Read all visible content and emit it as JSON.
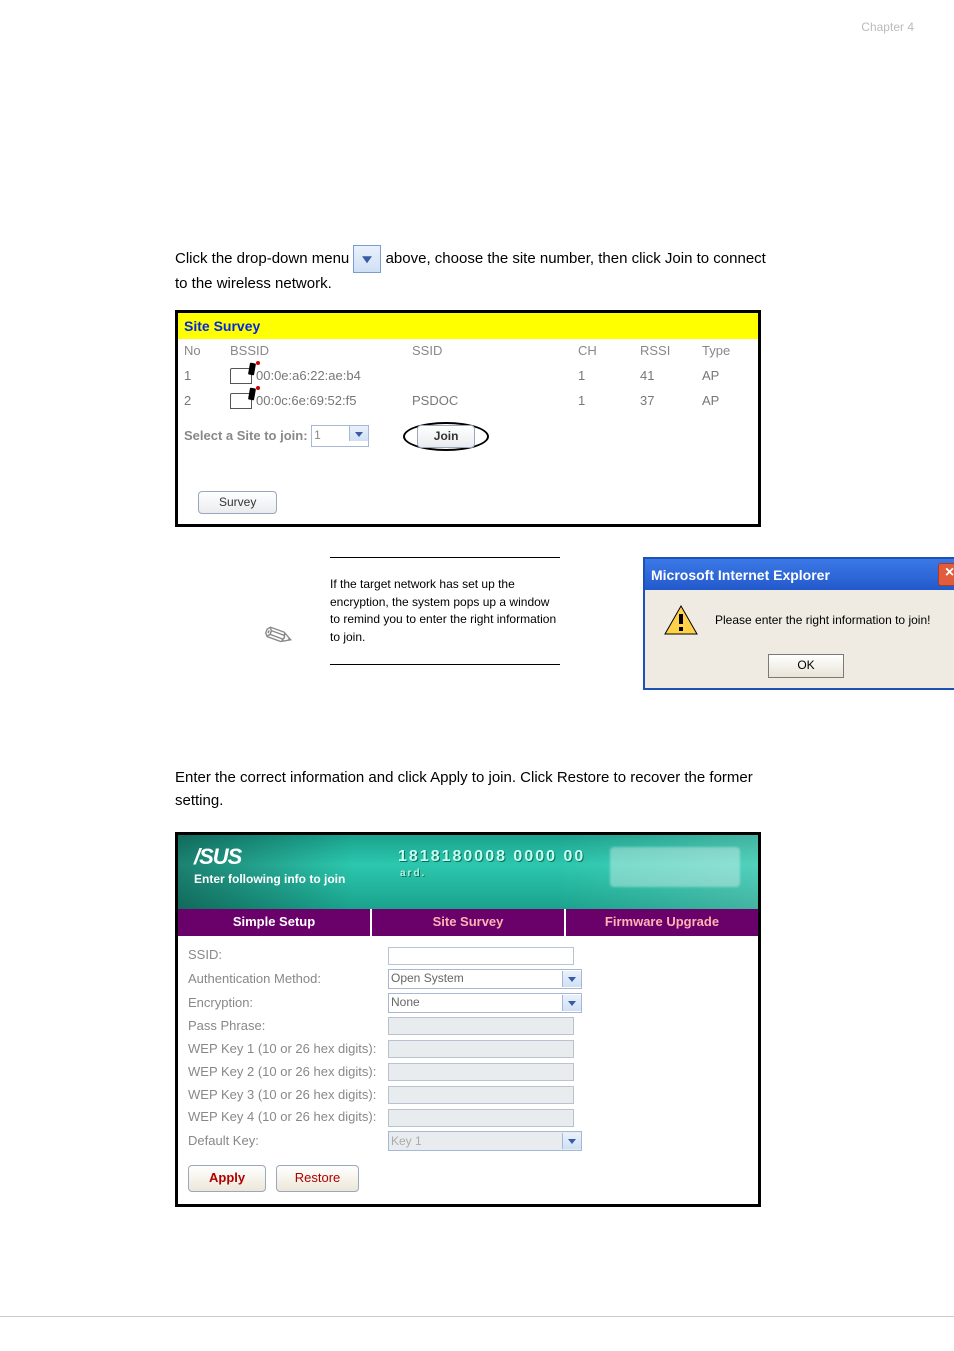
{
  "chapter_label": "Chapter 4",
  "body": {
    "p1_pre": "Click the drop-down menu ",
    "p1_post": " above, choose the site number, then click Join to connect to the wireless network.",
    "site_survey": {
      "title": "Site Survey",
      "headers": {
        "no": "No",
        "bssid": "BSSID",
        "ssid": "SSID",
        "ch": "CH",
        "rssi": "RSSI",
        "type": "Type"
      },
      "rows": [
        {
          "no": "1",
          "bssid": "00:0e:a6:22:ae:b4",
          "ssid": "",
          "ch": "1",
          "rssi": "41",
          "type": "AP"
        },
        {
          "no": "2",
          "bssid": "00:0c:6e:69:52:f5",
          "ssid": "PSDOC",
          "ch": "1",
          "rssi": "37",
          "type": "AP"
        }
      ],
      "select_label": "Select a Site to join:",
      "select_value": "1",
      "join_btn": "Join",
      "survey_btn": "Survey"
    },
    "note_text": "If the target network has set up the encryption, the system pops up a window to remind you to enter the right information to join.",
    "ie_dialog": {
      "title": "Microsoft Internet Explorer",
      "msg": "Please enter the right information to join!",
      "ok": "OK"
    },
    "p2": "Enter the correct information and click Apply to join. Click Restore to recover the former setting.",
    "asus": {
      "logo": "/SUS",
      "sub": "Enter following info to join",
      "mac": "1818180008 0000 00",
      "mac_sub": "ard.",
      "tabs": {
        "simple": "Simple Setup",
        "site": "Site Survey",
        "fw": "Firmware Upgrade"
      },
      "fields": {
        "ssid": "SSID:",
        "auth": "Authentication Method:",
        "auth_val": "Open System",
        "enc": "Encryption:",
        "enc_val": "None",
        "pass": "Pass Phrase:",
        "wep1": "WEP Key 1 (10 or 26 hex digits):",
        "wep2": "WEP Key 2 (10 or 26 hex digits):",
        "wep3": "WEP Key 3 (10 or 26 hex digits):",
        "wep4": "WEP Key 4 (10 or 26 hex digits):",
        "defkey": "Default Key:",
        "defkey_val": "Key 1"
      },
      "apply": "Apply",
      "restore": "Restore"
    }
  },
  "footer": {
    "left": "",
    "right": ""
  }
}
